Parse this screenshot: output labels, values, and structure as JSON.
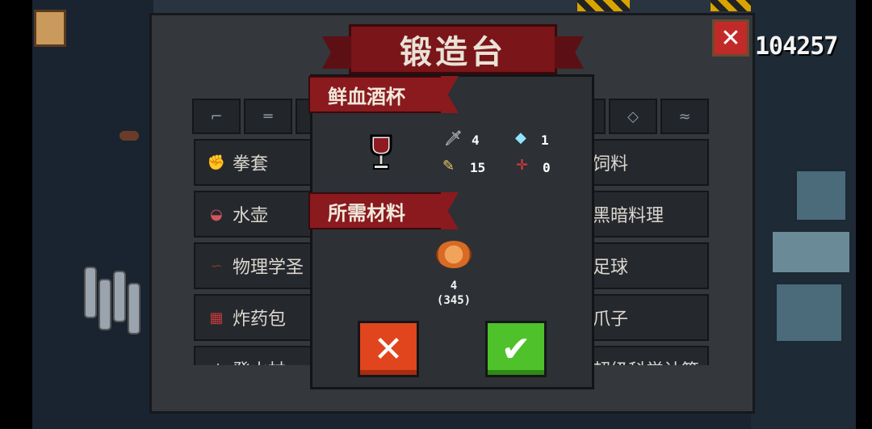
{
  "hud": {
    "score": "104257"
  },
  "forge": {
    "title": "锻造台",
    "tab_icons": [
      "pistol-icon",
      "rifle-icon",
      "shotgun-icon",
      "laser-icon",
      "star-target-icon",
      "fish-icon"
    ],
    "items_left": [
      {
        "icon": "gloves-icon",
        "label": "拳套"
      },
      {
        "icon": "kettle-icon",
        "label": "水壶"
      },
      {
        "icon": "crowbar-icon",
        "label": "物理学圣"
      },
      {
        "icon": "dynamite-icon",
        "label": "炸药包"
      },
      {
        "icon": "stick-icon",
        "label": "登山杖"
      }
    ],
    "items_right": [
      {
        "label": "饲料"
      },
      {
        "label": "黑暗料理"
      },
      {
        "label": "足球"
      },
      {
        "label": "爪子"
      },
      {
        "label": "超级科学计算"
      }
    ]
  },
  "popup": {
    "item_name": "鲜血酒杯",
    "stats": {
      "damage": "4",
      "energy": "1",
      "crit": "15",
      "accuracy": "0"
    },
    "materials_title": "所需材料",
    "material": {
      "icon": "meat-icon",
      "required": "4",
      "owned": "(345)"
    },
    "cancel_symbol": "✕",
    "confirm_symbol": "✔"
  },
  "close_symbol": "✕",
  "colors": {
    "ribbon": "#8a1a1e",
    "cancel": "#e0451d",
    "confirm": "#4fc12b"
  }
}
